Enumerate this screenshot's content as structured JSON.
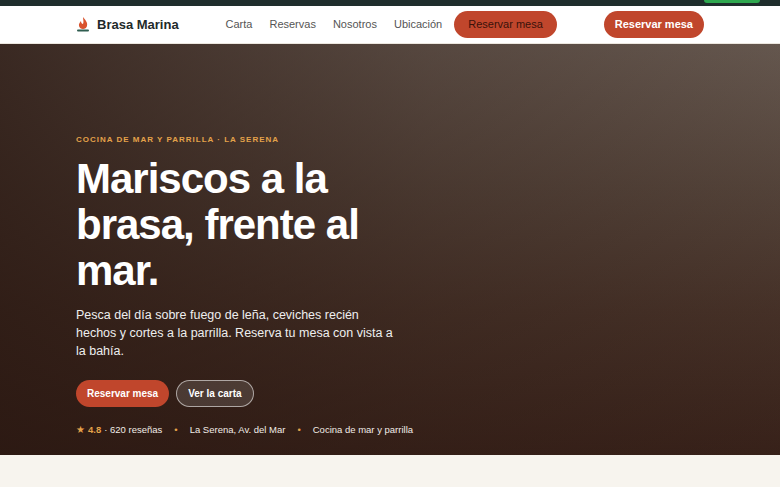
{
  "navbar": {
    "brand": "Brasa Marina",
    "links": [
      "Carta",
      "Reservas",
      "Nosotros",
      "Ubicación"
    ],
    "pill": "Reservar mesa",
    "cta": "Reservar mesa"
  },
  "hero": {
    "eyebrow": "COCINA DE MAR Y PARRILLA · LA SERENA",
    "title": "Mariscos a la brasa, frente al mar.",
    "text": "Pesca del día sobre fuego de leña, ceviches recién hechos y cortes a la parrilla. Reserva tu mesa con vista a la bahía.",
    "buttons": [
      {
        "label": "Reservar mesa",
        "kind": "primary"
      },
      {
        "label": "Ver la carta",
        "kind": "outline"
      }
    ],
    "rating": {
      "star": "★",
      "score": "4.8",
      "reviews": "· 620 reseñas"
    },
    "meta": [
      {
        "sep": "•",
        "text": "La Serena, Av. del Mar"
      },
      {
        "sep": "•",
        "text": "Cocina de mar y parrilla"
      }
    ]
  }
}
